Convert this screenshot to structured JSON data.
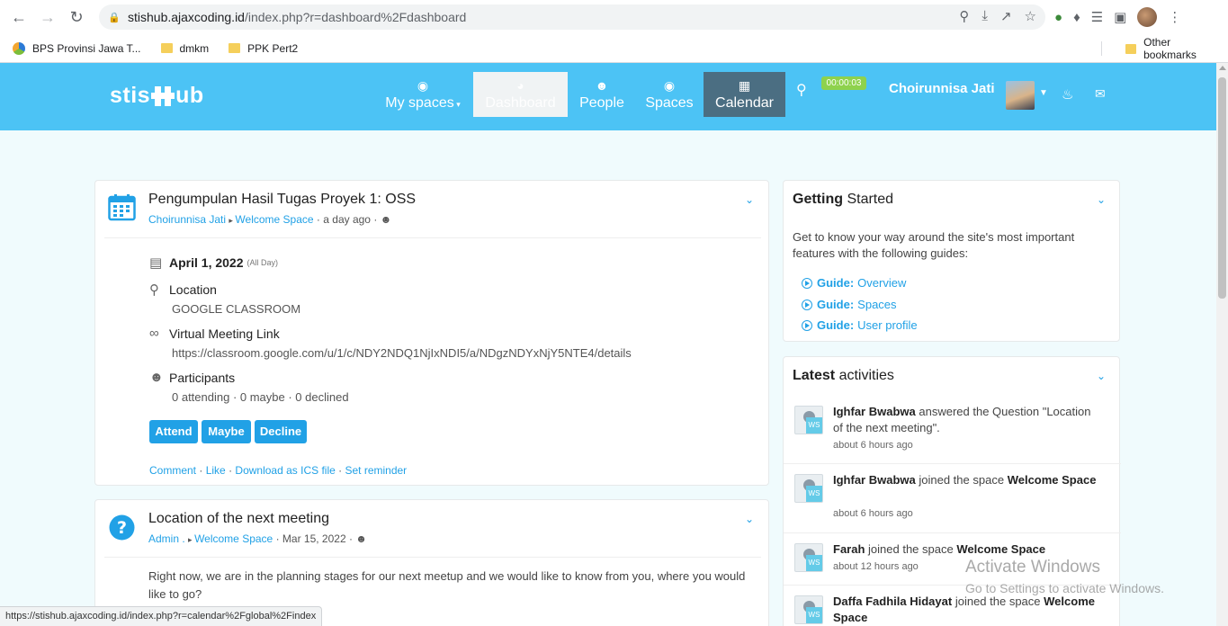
{
  "browser": {
    "url_host": "stishub.ajaxcoding.id",
    "url_rest": "/index.php?r=dashboard%2Fdashboard",
    "bookmarks": [
      "BPS Provinsi Jawa T...",
      "dmkm",
      "PPK Pert2"
    ],
    "other_bookmarks": "Other bookmarks",
    "status_url": "https://stishub.ajaxcoding.id/index.php?r=calendar%2Fglobal%2Findex"
  },
  "header": {
    "logo": "stis#ub",
    "logo_left": "stis",
    "logo_right": "ub",
    "nav": {
      "my_spaces": "My spaces",
      "dashboard": "Dashboard",
      "people": "People",
      "spaces": "Spaces",
      "calendar": "Calendar"
    },
    "timer": "00:00:03",
    "user_name": "Choirunnisa Jati",
    "brand_color": "#4cc3f5"
  },
  "post1": {
    "title": "Pengumpulan Hasil Tugas Proyek 1: OSS",
    "author": "Choirunnisa Jati",
    "space": "Welcome Space",
    "time": "a day ago",
    "date": "April 1, 2022",
    "all_day": "(All Day)",
    "location_label": "Location",
    "location_value": "GOOGLE CLASSROOM",
    "vml_label": "Virtual Meeting Link",
    "vml_value": "https://classroom.google.com/u/1/c/NDY2NDQ1NjIxNDI5/a/NDgzNDYxNjY5NTE4/details",
    "participants_label": "Participants",
    "participants_value": "0 attending · 0 maybe · 0 declined",
    "btn_attend": "Attend",
    "btn_maybe": "Maybe",
    "btn_decline": "Decline",
    "action_comment": "Comment",
    "action_like": "Like",
    "action_ics": "Download as ICS file",
    "action_reminder": "Set reminder"
  },
  "post2": {
    "title": "Location of the next meeting",
    "author": "Admin .",
    "space": "Welcome Space",
    "time": "Mar 15, 2022",
    "body": "Right now, we are in the planning stages for our next meetup and we would like to know from you, where you would like to go?"
  },
  "getting_started": {
    "title_bold": "Getting",
    "title_rest": "Started",
    "text": "Get to know your way around the site's most important features with the following guides:",
    "guide_label": "Guide:",
    "guides": [
      "Overview",
      "Spaces",
      "User profile"
    ]
  },
  "latest": {
    "title_bold": "Latest",
    "title_rest": "activities",
    "items": [
      {
        "user": "Ighfar Bwabwa",
        "action": "answered the Question",
        "target": "\"Location of the next meeting\".",
        "time": "about 6 hours ago"
      },
      {
        "user": "Ighfar Bwabwa",
        "action": "joined the space",
        "target": "Welcome Space",
        "time": "about 6 hours ago"
      },
      {
        "user": "Farah",
        "action": "joined the space",
        "target": "Welcome Space",
        "time": "about 12 hours ago"
      },
      {
        "user": "Daffa Fadhila Hidayat",
        "action": "joined the space",
        "target": "Welcome Space",
        "time": ""
      }
    ],
    "ws_badge": "WS"
  },
  "watermark": {
    "line1": "Activate Windows",
    "line2": "Go to Settings to activate Windows."
  }
}
